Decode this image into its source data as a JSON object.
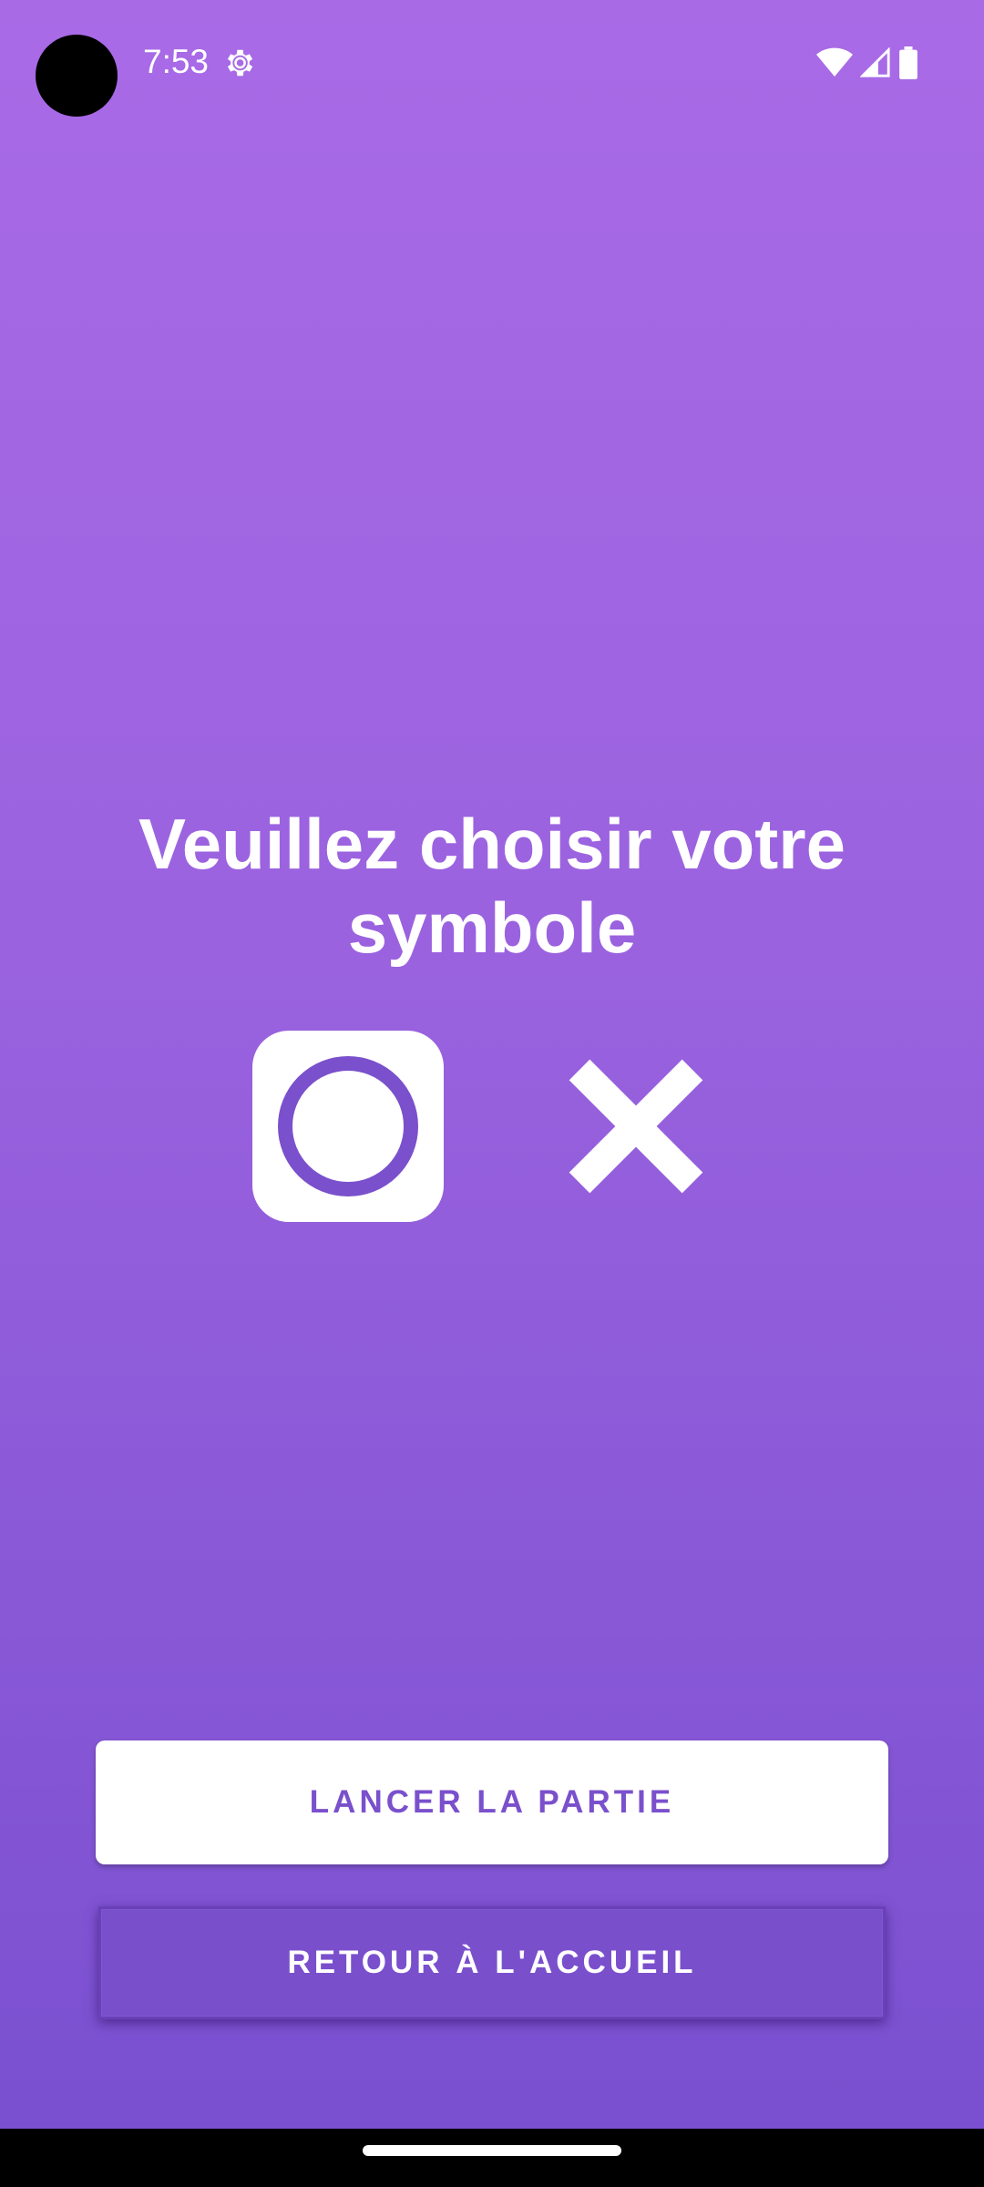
{
  "status_bar": {
    "time": "7:53",
    "icons": [
      "settings-icon",
      "wifi-icon",
      "signal-icon",
      "battery-icon"
    ]
  },
  "main": {
    "prompt": "Veuillez choisir votre symbole",
    "symbols": [
      {
        "name": "O",
        "selected": true
      },
      {
        "name": "X",
        "selected": false
      }
    ]
  },
  "buttons": {
    "start_label": "LANCER LA PARTIE",
    "home_label": "RETOUR À L'ACCUEIL"
  },
  "colors": {
    "background_top": "#a96ae6",
    "background_bottom": "#7a50d0",
    "accent": "#7a50cc",
    "white": "#ffffff"
  }
}
